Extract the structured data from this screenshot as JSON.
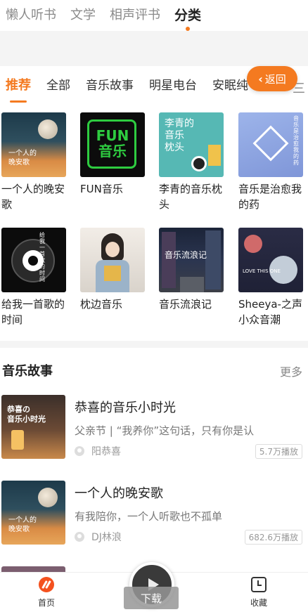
{
  "top_tabs": [
    "懒人听书",
    "文学",
    "相声评书",
    "分类"
  ],
  "sub_tabs": [
    "推荐",
    "全部",
    "音乐故事",
    "明星电台",
    "安眠纯"
  ],
  "sub_more_glyph": "三",
  "back_button": {
    "label": "返回"
  },
  "grid": [
    {
      "title": "一个人的晚安歌",
      "cover_text": "一个人的\n晚安歌"
    },
    {
      "title": "FUN音乐",
      "cover_text": "FUN\n音乐"
    },
    {
      "title": "李青的音乐枕头",
      "cover_text": "李青的\n音乐\n枕头"
    },
    {
      "title": "音乐是治愈我的药",
      "cover_text": "音乐是治愈我的药"
    },
    {
      "title": "给我一首歌的时间",
      "cover_text": "给我一首歌的时间"
    },
    {
      "title": "枕边音乐",
      "cover_text": ""
    },
    {
      "title": "音乐流浪记",
      "cover_text": "音乐流浪记"
    },
    {
      "title": "Sheeya-之声小众音潮",
      "cover_text": "LOVE THIS ONE"
    }
  ],
  "section": {
    "title": "音乐故事",
    "more": "更多"
  },
  "list": [
    {
      "title": "恭喜的音乐小时光",
      "desc": "父亲节 | “我养你”这句话，只有你是认",
      "author": "阳恭喜",
      "plays": "5.7万播放",
      "cover_text": "恭喜の\n音乐小时光"
    },
    {
      "title": "一个人的晚安歌",
      "desc": "有我陪你，一个人听歌也不孤单",
      "author": "DJ林浪",
      "plays": "682.6万播放",
      "cover_text": "一个人的\n晚安歌"
    }
  ],
  "bottom_nav": {
    "home": "首页",
    "download": "下载",
    "favorites": "收藏"
  },
  "colors": {
    "accent": "#f47a20",
    "text": "#222222",
    "muted": "#888888"
  }
}
